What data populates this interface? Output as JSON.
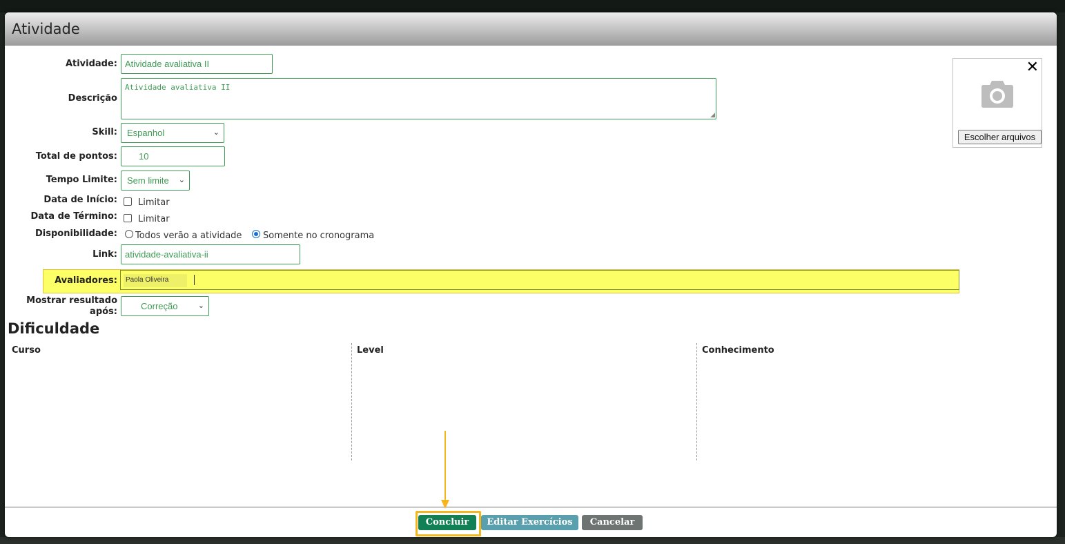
{
  "dialog": {
    "title": "Atividade"
  },
  "form": {
    "atividade_label": "Atividade:",
    "atividade_value": "Atividade avaliativa II",
    "descricao_label": "Descrição",
    "descricao_value": "Atividade avaliativa II",
    "skill_label": "Skill:",
    "skill_value": "Espanhol",
    "pontos_label": "Total de pontos:",
    "pontos_value": "10",
    "tempo_label": "Tempo Limite:",
    "tempo_value": "Sem limite",
    "inicio_label": "Data de Início:",
    "inicio_option": "Limitar",
    "termino_label": "Data de Término:",
    "termino_option": "Limitar",
    "disponibilidade_label": "Disponibilidade:",
    "disponibilidade_options": [
      "Todos verão a atividade",
      "Somente no cronograma"
    ],
    "disponibilidade_selected": "Somente no cronograma",
    "link_label": "Link:",
    "link_value": "atividade-avaliativa-ii",
    "avaliadores_label": "Avaliadores:",
    "avaliadores_tags": [
      "Paola Oliveira"
    ],
    "mostrar_label_line1": "Mostrar resultado",
    "mostrar_label_line2": "após:",
    "mostrar_value": "Correção"
  },
  "dificuldade": {
    "title": "Dificuldade",
    "columns": [
      "Curso",
      "Level",
      "Conhecimento"
    ]
  },
  "photo": {
    "choose_label": "Escolher arquivos",
    "close_symbol": "✕"
  },
  "footer": {
    "concluir": "Concluir",
    "editar": "Editar Exercícios",
    "cancelar": "Cancelar"
  },
  "colors": {
    "primary": "#128055",
    "info": "#5a9fae",
    "neutral": "#6e7471",
    "field_green": "#3f9a55",
    "highlight_yellow": "#fdff66",
    "annotation_orange": "#f3b61c"
  }
}
